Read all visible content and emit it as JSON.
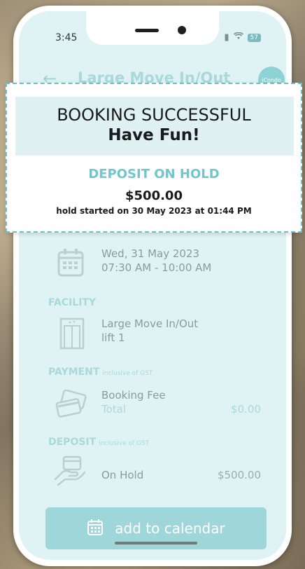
{
  "status_bar": {
    "time": "3:45",
    "battery": "57"
  },
  "header": {
    "title": "Large Move In/Out",
    "logo_text": "iCondo"
  },
  "popup": {
    "title": "BOOKING SUCCESSFUL",
    "subtitle": "Have Fun!",
    "deposit_label": "DEPOSIT ON HOLD",
    "amount": "$500.00",
    "started": "hold started on 30 May 2023 at 01:44 PM"
  },
  "schedule": {
    "date": "Wed, 31 May 2023",
    "time_range": "07:30 AM - 10:00 AM"
  },
  "facility": {
    "label": "FACILITY",
    "name": "Large Move In/Out",
    "detail": "lift 1"
  },
  "payment": {
    "label": "PAYMENT",
    "note": "inclusive of GST",
    "item": "Booking Fee",
    "total_label": "Total",
    "total_value": "$0.00"
  },
  "deposit": {
    "label": "DEPOSIT",
    "note": "inclusive of GST",
    "status": "On Hold",
    "value": "$500.00"
  },
  "actions": {
    "calendar_label": "add to calendar"
  },
  "colors": {
    "accent": "#6fc7cc",
    "screen_bg": "#dff3f4",
    "button": "#9fd6d9"
  },
  "icons": [
    "back-arrow-icon",
    "wifi-icon",
    "battery-icon",
    "calendar-icon",
    "elevator-icon",
    "credit-card-icon",
    "hand-card-icon",
    "calendar-add-icon"
  ]
}
